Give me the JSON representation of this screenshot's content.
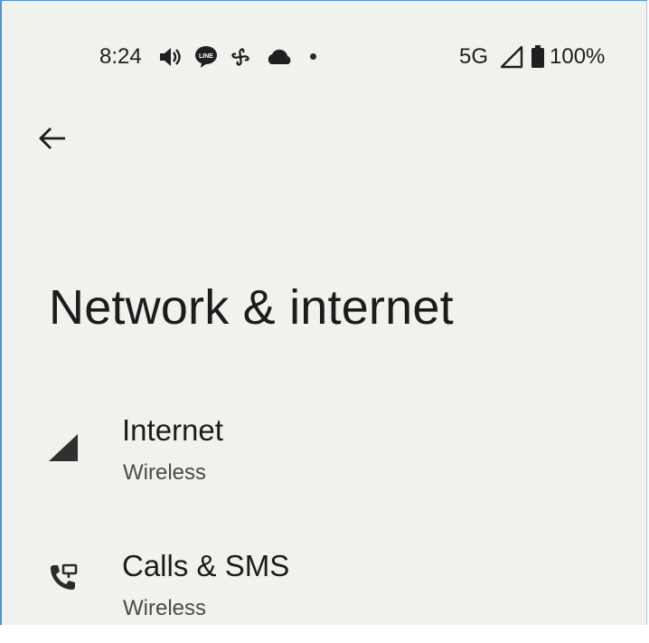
{
  "status_bar": {
    "time": "8:24",
    "network": "5G",
    "battery": "100%",
    "icons": [
      "volume-icon",
      "line-app-icon",
      "pinwheel-icon",
      "cloud-icon",
      "notification-dot",
      "signal-icon",
      "battery-icon"
    ]
  },
  "header": {
    "back_icon": "arrow-left-icon"
  },
  "page": {
    "title": "Network & internet"
  },
  "items": [
    {
      "label": "Internet",
      "summary": "Wireless",
      "icon": "signal-icon"
    },
    {
      "label": "Calls & SMS",
      "summary": "Wireless",
      "icon": "phone-forwarded-icon"
    }
  ],
  "colors": {
    "background": "#f1f2ee",
    "text": "#1c1c1c",
    "secondary": "#4a4a4a"
  }
}
